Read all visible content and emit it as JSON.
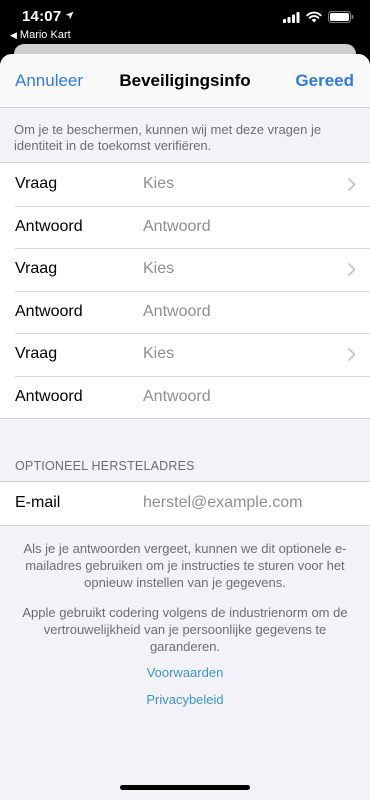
{
  "status_bar": {
    "time": "14:07",
    "back_app": "Mario Kart",
    "back_icon": "chevron-left-small",
    "location_icon": "location-arrow",
    "icons": [
      "cellular-signal",
      "wifi",
      "battery"
    ]
  },
  "navbar": {
    "cancel_label": "Annuleer",
    "title": "Beveiligingsinfo",
    "done_label": "Gereed"
  },
  "intro_text": "Om je te beschermen, kunnen wij met deze vragen je identiteit in de toekomst verifiëren.",
  "questions": [
    {
      "question_label": "Vraag",
      "question_value": "Kies",
      "answer_label": "Antwoord",
      "answer_placeholder": "Antwoord"
    },
    {
      "question_label": "Vraag",
      "question_value": "Kies",
      "answer_label": "Antwoord",
      "answer_placeholder": "Antwoord"
    },
    {
      "question_label": "Vraag",
      "question_value": "Kies",
      "answer_label": "Antwoord",
      "answer_placeholder": "Antwoord"
    }
  ],
  "recovery": {
    "section_header": "OPTIONEEL HERSTELADRES",
    "email_label": "E-mail",
    "email_placeholder": "herstel@example.com"
  },
  "footer": {
    "paragraph_1": "Als je je antwoorden vergeet, kunnen we dit optionele e-mailadres gebruiken om je instructies te sturen voor het opnieuw instellen van je gegevens.",
    "paragraph_2": "Apple gebruikt codering volgens de industrienorm om de vertrouwelijkheid van je persoonlijke gegevens te garanderen.",
    "terms_link": "Voorwaarden",
    "privacy_link": "Privacybeleid"
  },
  "colors": {
    "accent": "#2f7be0",
    "link": "#3b93d1",
    "background": "#f2f2f7",
    "secondary_text": "#6d6d72"
  }
}
